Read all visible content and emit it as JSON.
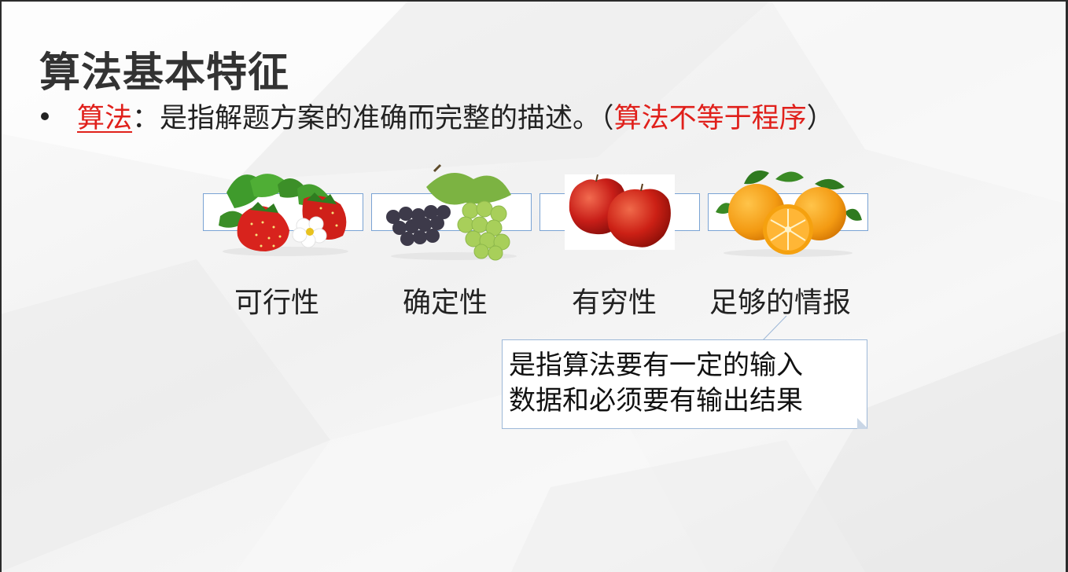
{
  "title": "算法基本特征",
  "bullet": {
    "term": "算法",
    "colon": "：",
    "definition": "是指解题方案的准确而完整的描述。",
    "paren_open": "（",
    "note": "算法不等于程序",
    "paren_close": "）"
  },
  "features": [
    {
      "label": "可行性",
      "icon": "strawberry-icon"
    },
    {
      "label": "确定性",
      "icon": "grapes-icon"
    },
    {
      "label": "有穷性",
      "icon": "apple-icon"
    },
    {
      "label": "足够的情报",
      "icon": "orange-icon"
    }
  ],
  "callout": {
    "line1": "是指算法要有一定的输入",
    "line2": "数据和必须要有输出结果"
  },
  "colors": {
    "accent_red": "#e0201b",
    "border_blue": "#7aa3d4",
    "text": "#222222"
  }
}
